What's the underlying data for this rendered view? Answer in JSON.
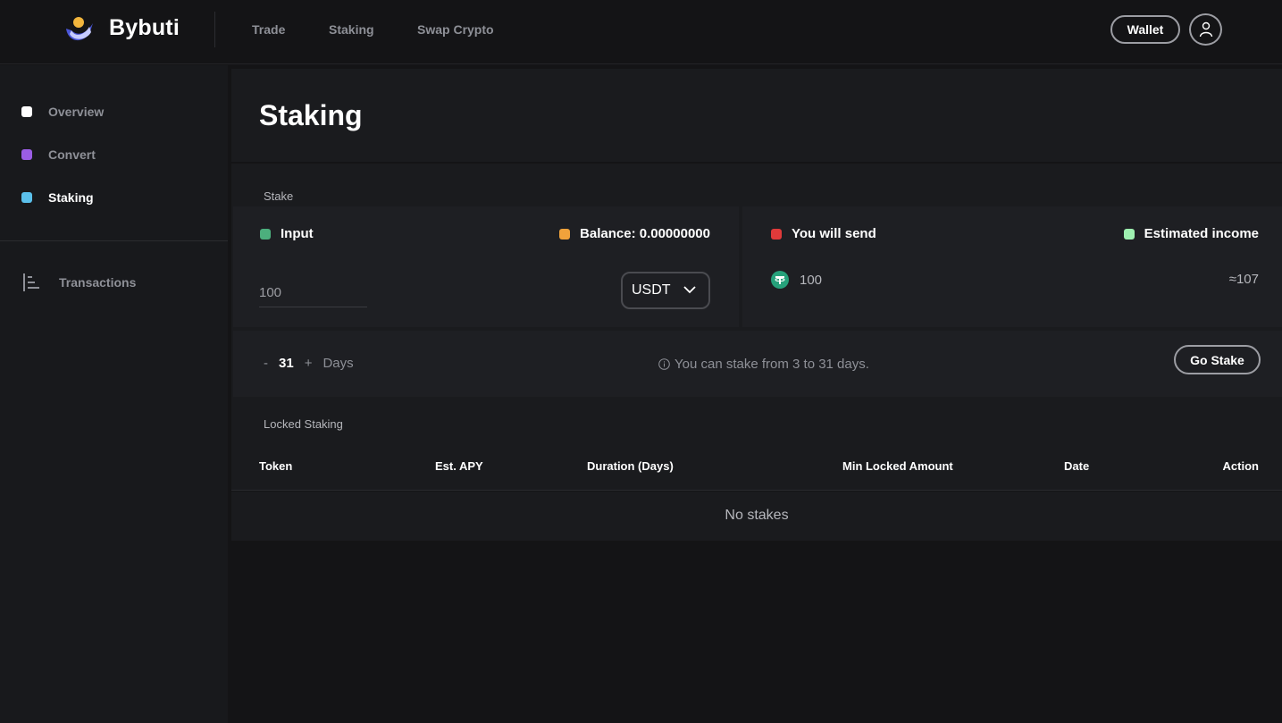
{
  "header": {
    "brand": "Bybuti",
    "nav": [
      {
        "label": "Trade"
      },
      {
        "label": "Staking"
      },
      {
        "label": "Swap Crypto"
      }
    ],
    "wallet_label": "Wallet"
  },
  "sidebar": {
    "items": [
      {
        "label": "Overview",
        "color": "#ffffff"
      },
      {
        "label": "Convert",
        "color": "#9b5de5"
      },
      {
        "label": "Staking",
        "color": "#5bc0eb"
      }
    ],
    "transactions_label": "Transactions"
  },
  "page": {
    "title": "Staking"
  },
  "stake": {
    "section_label": "Stake",
    "input_label": "Input",
    "input_dot_color": "#4caf7d",
    "balance_label": "Balance: 0.00000000",
    "balance_dot_color": "#f0a23b",
    "amount_value": "100",
    "token": "USDT",
    "send_label": "You will send",
    "send_dot_color": "#e03a3a",
    "send_amount": "100",
    "income_label": "Estimated income",
    "income_dot_color": "#9ef0b0",
    "income_value": "≈107",
    "days_minus": "-",
    "days_value": "31",
    "days_plus": "+",
    "days_unit": "Days",
    "hint": "You can stake from 3 to 31 days.",
    "go_stake_label": "Go Stake"
  },
  "locked": {
    "section_label": "Locked Staking",
    "columns": [
      "Token",
      "Est. APY",
      "Duration (Days)",
      "Min Locked Amount",
      "Date",
      "Action"
    ],
    "empty_text": "No stakes"
  }
}
